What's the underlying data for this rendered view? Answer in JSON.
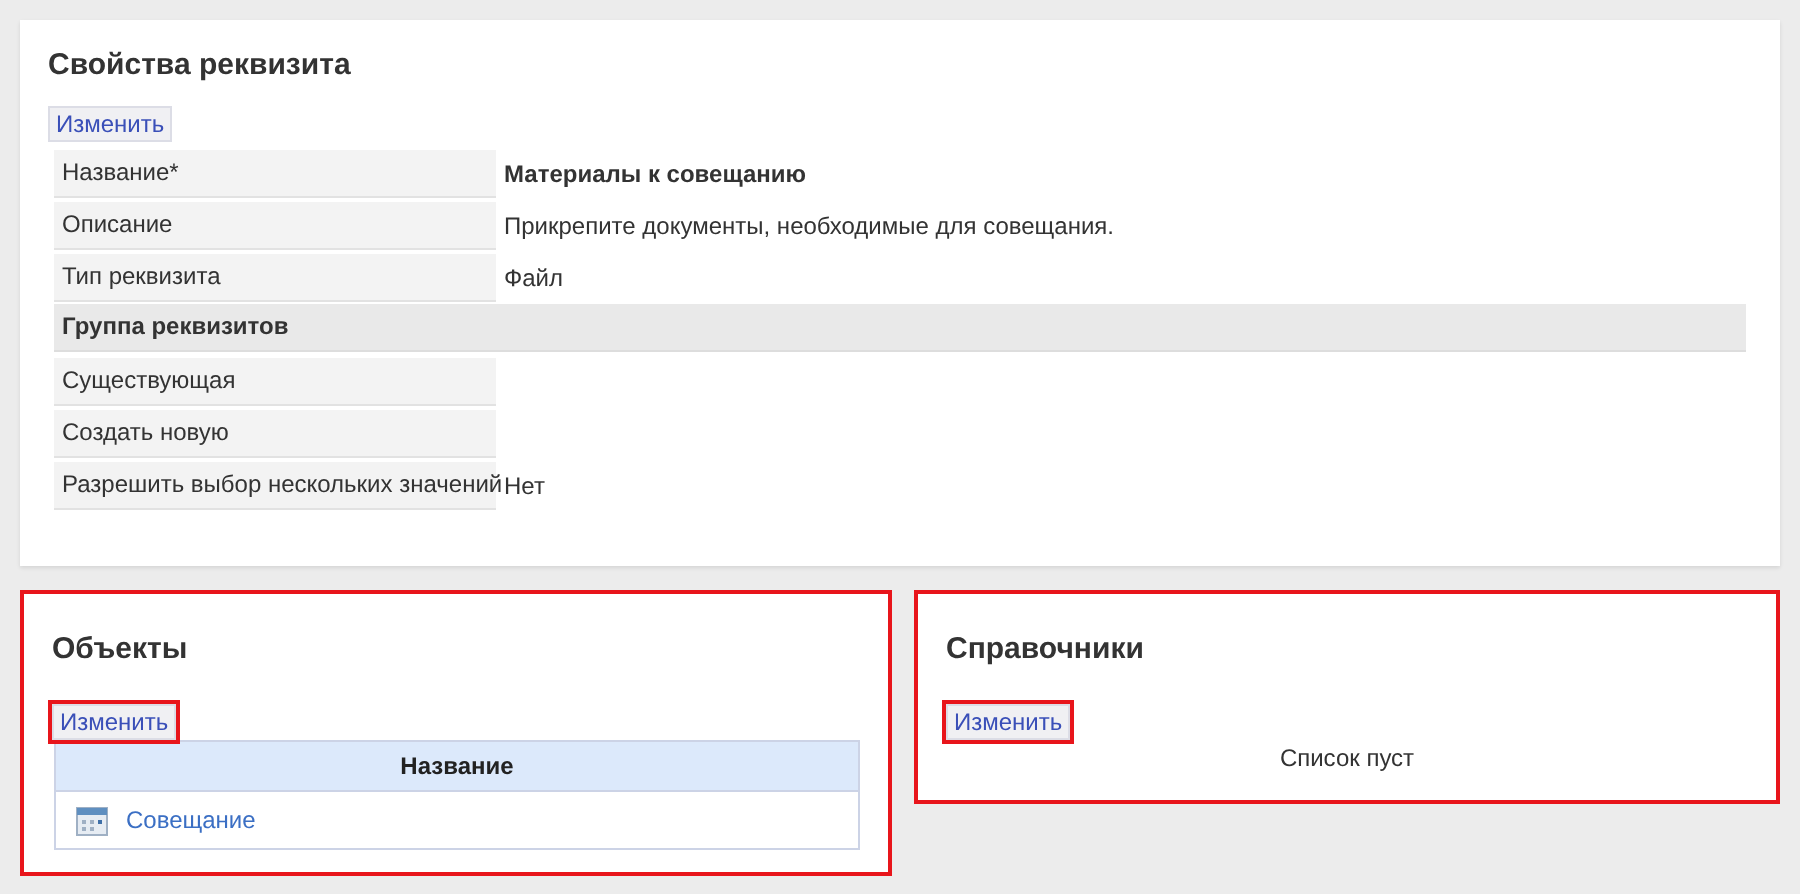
{
  "properties": {
    "title": "Свойства реквизита",
    "edit_button": "Изменить",
    "rows": [
      {
        "kind": "field",
        "label": "Название*",
        "value": "Материалы к совещанию",
        "emphasis": true
      },
      {
        "kind": "field",
        "label": "Описание",
        "value": "Прикрепите документы, необходимые для совещания.",
        "emphasis": false
      },
      {
        "kind": "field",
        "label": "Тип реквизита",
        "value": "Файл",
        "emphasis": false
      },
      {
        "kind": "group",
        "label": "Группа реквизитов"
      },
      {
        "kind": "field",
        "label": "Существующая"
      },
      {
        "kind": "field",
        "label": "Создать новую"
      },
      {
        "kind": "field",
        "label": "Разрешить выбор нескольких значений",
        "value": "Нет",
        "emphasis": false
      }
    ]
  },
  "objects": {
    "title": "Объекты",
    "highlighted": true,
    "edit_button": {
      "label": "Изменить",
      "highlighted": true
    },
    "table": {
      "columns": [
        "Название"
      ],
      "rows": [
        {
          "name": "Совещание"
        }
      ]
    }
  },
  "directories": {
    "title": "Справочники",
    "highlighted": true,
    "edit_button": {
      "label": "Изменить",
      "highlighted": true
    },
    "empty_text": "Список пуст"
  }
}
